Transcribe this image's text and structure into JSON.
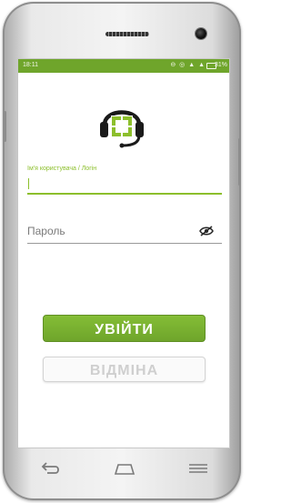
{
  "statusbar": {
    "time": "18:11",
    "icons": "⊖ ◎ ▲ ▲",
    "battery": "31%"
  },
  "login": {
    "username_label": "Ім'я користувача / Логін",
    "username_value": "",
    "password_placeholder": "Пароль",
    "login_button": "УВІЙТИ",
    "cancel_button": "ВІДМІНА"
  },
  "colors": {
    "accent": "#8cbf2c",
    "statusbar": "#6fa52b",
    "button": "#79b030"
  },
  "icons": {
    "logo": "headset-support-icon",
    "password_toggle": "eye-off-icon",
    "nav_back": "back-icon",
    "nav_home": "home-icon",
    "nav_menu": "menu-icon"
  }
}
